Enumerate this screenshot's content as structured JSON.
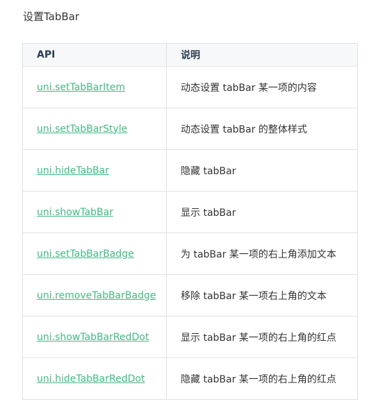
{
  "title": "设置TabBar",
  "table": {
    "headers": {
      "api": "API",
      "desc": "说明"
    },
    "rows": [
      {
        "api": "uni.setTabBarItem",
        "desc": "动态设置 tabBar 某一项的内容"
      },
      {
        "api": "uni.setTabBarStyle",
        "desc": "动态设置 tabBar 的整体样式"
      },
      {
        "api": "uni.hideTabBar",
        "desc": "隐藏 tabBar"
      },
      {
        "api": "uni.showTabBar",
        "desc": "显示 tabBar"
      },
      {
        "api": "uni.setTabBarBadge",
        "desc": "为 tabBar 某一项的右上角添加文本"
      },
      {
        "api": "uni.removeTabBarBadge",
        "desc": "移除 tabBar 某一项右上角的文本"
      },
      {
        "api": "uni.showTabBarRedDot",
        "desc": "显示 tabBar 某一项的右上角的红点"
      },
      {
        "api": "uni.hideTabBarRedDot",
        "desc": "隐藏 tabBar 某一项的右上角的红点"
      }
    ]
  },
  "colors": {
    "link": "#42b983",
    "border": "#dfe2e5",
    "header_bg": "#f6f8fa"
  }
}
